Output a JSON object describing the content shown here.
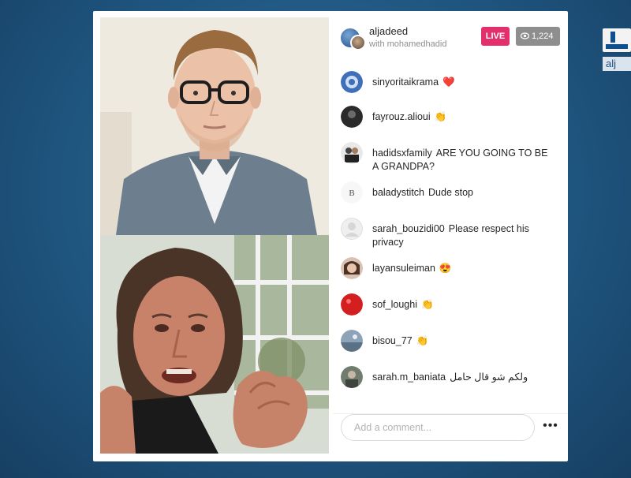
{
  "header": {
    "host_name": "aljadeed",
    "subtitle": "with mohamedhadid",
    "live_label": "LIVE",
    "viewer_count": "1,224"
  },
  "comments": [
    {
      "user": "sinyoritaikrama",
      "text": "❤️",
      "avatar": "blue-avatar"
    },
    {
      "user": "fayrouz.alioui",
      "text": "👏",
      "avatar": "dark-avatar"
    },
    {
      "user": "hadidsxfamily",
      "text": "ARE YOU GOING TO BE A GRANDPA?",
      "avatar": "couple-avatar"
    },
    {
      "user": "baladystitch",
      "text": "Dude stop",
      "avatar": "logo-avatar"
    },
    {
      "user": "sarah_bouzidi00",
      "text": "Please respect his privacy",
      "avatar": "blank-avatar"
    },
    {
      "user": "layansuleiman",
      "text": "😍",
      "avatar": "woman-avatar"
    },
    {
      "user": "sof_loughi",
      "text": "👏",
      "avatar": "red-avatar"
    },
    {
      "user": "bisou_77",
      "text": "👏",
      "avatar": "scenery-avatar"
    },
    {
      "user": "sarah.m_baniata",
      "text": "ولكم شو قال حامل",
      "avatar": "grey-avatar"
    }
  ],
  "input": {
    "placeholder": "Add a comment..."
  },
  "more_label": "•••",
  "colors": {
    "live": "#e1306c",
    "viewers": "#8e8e8e",
    "background": "#1f5680"
  }
}
